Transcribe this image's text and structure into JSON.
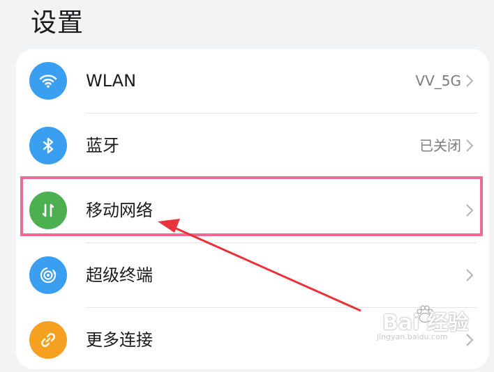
{
  "page": {
    "title": "设置"
  },
  "rows": [
    {
      "label": "WLAN",
      "value": "VV_5G",
      "icon": "wifi-icon",
      "icon_color": "#3a9ff0"
    },
    {
      "label": "蓝牙",
      "value": "已关闭",
      "icon": "bluetooth-icon",
      "icon_color": "#3a9ff0"
    },
    {
      "label": "移动网络",
      "value": "",
      "icon": "mobile-data-icon",
      "icon_color": "#4caf50"
    },
    {
      "label": "超级终端",
      "value": "",
      "icon": "super-device-icon",
      "icon_color": "#3a9ff0"
    },
    {
      "label": "更多连接",
      "value": "",
      "icon": "link-icon",
      "icon_color": "#f5a020"
    }
  ],
  "watermark": {
    "brand": "Bai  经验",
    "url": "jingyan.baidu.com"
  },
  "annotation": {
    "highlight_color": "#f06a93",
    "arrow_color": "#e8333a"
  }
}
